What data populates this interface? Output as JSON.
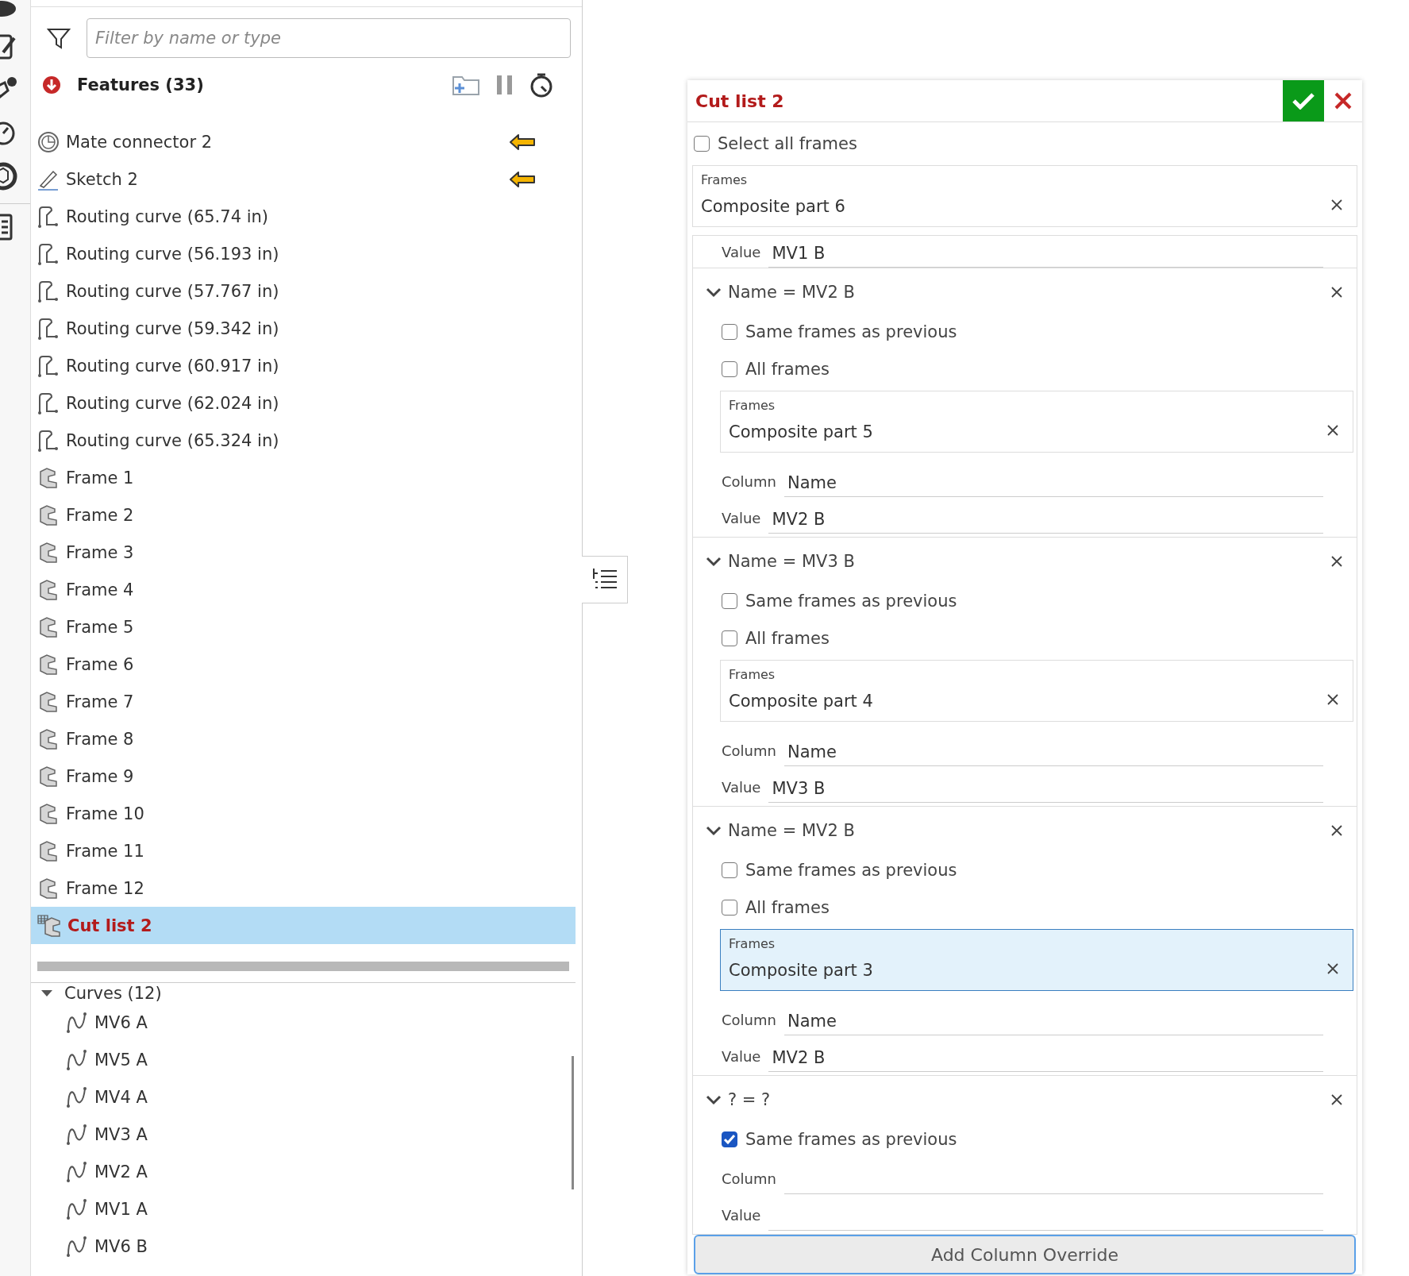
{
  "filter": {
    "placeholder": "Filter by name or type"
  },
  "features": {
    "title": "Features (33)",
    "items": [
      {
        "kind": "mate",
        "label": "Mate connector 2",
        "marker": true,
        "selected": false
      },
      {
        "kind": "sketch",
        "label": "Sketch 2",
        "marker": true,
        "selected": false
      },
      {
        "kind": "routing",
        "label": "Routing curve (65.74 in)",
        "marker": false,
        "selected": false
      },
      {
        "kind": "routing",
        "label": "Routing curve (56.193 in)",
        "marker": false,
        "selected": false
      },
      {
        "kind": "routing",
        "label": "Routing curve (57.767 in)",
        "marker": false,
        "selected": false
      },
      {
        "kind": "routing",
        "label": "Routing curve (59.342 in)",
        "marker": false,
        "selected": false
      },
      {
        "kind": "routing",
        "label": "Routing curve (60.917 in)",
        "marker": false,
        "selected": false
      },
      {
        "kind": "routing",
        "label": "Routing curve (62.024 in)",
        "marker": false,
        "selected": false
      },
      {
        "kind": "routing",
        "label": "Routing curve (65.324 in)",
        "marker": false,
        "selected": false
      },
      {
        "kind": "frame",
        "label": "Frame 1",
        "marker": false,
        "selected": false
      },
      {
        "kind": "frame",
        "label": "Frame 2",
        "marker": false,
        "selected": false
      },
      {
        "kind": "frame",
        "label": "Frame 3",
        "marker": false,
        "selected": false
      },
      {
        "kind": "frame",
        "label": "Frame 4",
        "marker": false,
        "selected": false
      },
      {
        "kind": "frame",
        "label": "Frame 5",
        "marker": false,
        "selected": false
      },
      {
        "kind": "frame",
        "label": "Frame 6",
        "marker": false,
        "selected": false
      },
      {
        "kind": "frame",
        "label": "Frame 7",
        "marker": false,
        "selected": false
      },
      {
        "kind": "frame",
        "label": "Frame 8",
        "marker": false,
        "selected": false
      },
      {
        "kind": "frame",
        "label": "Frame 9",
        "marker": false,
        "selected": false
      },
      {
        "kind": "frame",
        "label": "Frame 10",
        "marker": false,
        "selected": false
      },
      {
        "kind": "frame",
        "label": "Frame 11",
        "marker": false,
        "selected": false
      },
      {
        "kind": "frame",
        "label": "Frame 12",
        "marker": false,
        "selected": false
      },
      {
        "kind": "cutlist",
        "label": "Cut list 2",
        "marker": false,
        "selected": true
      }
    ]
  },
  "curves": {
    "label": "Curves (12)",
    "expanded": true,
    "items": [
      {
        "label": "MV6 A",
        "selected": false
      },
      {
        "label": "MV5 A",
        "selected": false
      },
      {
        "label": "MV4 A",
        "selected": false
      },
      {
        "label": "MV3 A",
        "selected": false
      },
      {
        "label": "MV2 A",
        "selected": false
      },
      {
        "label": "MV1 A",
        "selected": false
      },
      {
        "label": "MV6 B",
        "selected": false
      }
    ]
  },
  "dialog": {
    "title": "Cut list 2",
    "select_all": {
      "label": "Select all frames",
      "checked": false
    },
    "frames": {
      "label": "Frames",
      "value": "Composite part 6",
      "focused": false
    },
    "first_value": {
      "label": "Value",
      "value": "MV1 B"
    },
    "overrides": [
      {
        "title": "Name = MV2 B",
        "expanded": true,
        "same_as_previous": {
          "label": "Same frames as previous",
          "checked": false
        },
        "all_frames": {
          "label": "All frames",
          "checked": false
        },
        "frames": {
          "label": "Frames",
          "value": "Composite part 5",
          "focused": false
        },
        "column": {
          "label": "Column",
          "value": "Name"
        },
        "value": {
          "label": "Value",
          "value": "MV2 B"
        }
      },
      {
        "title": "Name = MV3 B",
        "expanded": true,
        "same_as_previous": {
          "label": "Same frames as previous",
          "checked": false
        },
        "all_frames": {
          "label": "All frames",
          "checked": false
        },
        "frames": {
          "label": "Frames",
          "value": "Composite part 4",
          "focused": false
        },
        "column": {
          "label": "Column",
          "value": "Name"
        },
        "value": {
          "label": "Value",
          "value": "MV3 B"
        }
      },
      {
        "title": "Name = MV2 B",
        "expanded": true,
        "same_as_previous": {
          "label": "Same frames as previous",
          "checked": false
        },
        "all_frames": {
          "label": "All frames",
          "checked": false
        },
        "frames": {
          "label": "Frames",
          "value": "Composite part 3",
          "focused": true
        },
        "column": {
          "label": "Column",
          "value": "Name"
        },
        "value": {
          "label": "Value",
          "value": "MV2 B"
        }
      },
      {
        "title": "? = ?",
        "expanded": true,
        "same_as_previous": {
          "label": "Same frames as previous",
          "checked": true
        },
        "column": {
          "label": "Column"
        },
        "value": {
          "label": "Value"
        }
      }
    ],
    "add_button": "Add Column Override"
  }
}
